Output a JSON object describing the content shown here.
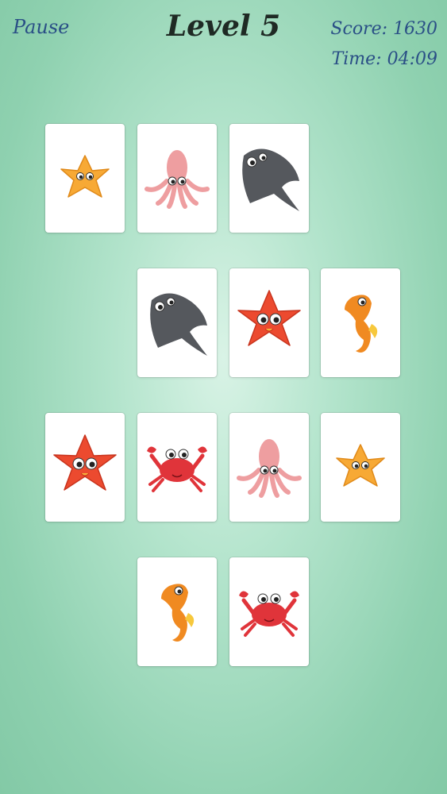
{
  "hud": {
    "pause_label": "Pause",
    "level_label": "Level 5",
    "score_label": "Score: 1630",
    "time_label": "Time: 04:09"
  },
  "board": {
    "rows": [
      [
        "orange-starfish",
        "pink-squid",
        "gray-stingray",
        null
      ],
      [
        null,
        "gray-stingray",
        "red-starfish",
        "orange-seahorse"
      ],
      [
        "red-starfish",
        "red-crab",
        "pink-squid",
        "orange-starfish"
      ],
      [
        null,
        "orange-seahorse",
        "red-crab",
        null
      ]
    ]
  },
  "colors": {
    "orange-starfish": "#f7a935",
    "red-starfish": "#ec4a2f",
    "pink-squid": "#ee9ea0",
    "gray-stingray": "#55585d",
    "orange-seahorse": "#f08a21",
    "red-crab": "#e0343a"
  }
}
